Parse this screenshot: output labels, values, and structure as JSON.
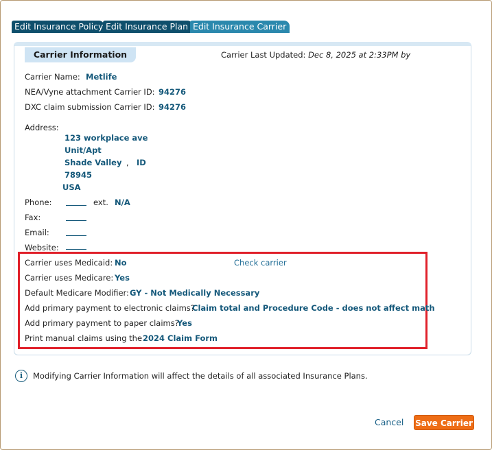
{
  "tabs": [
    {
      "label": "Edit Insurance Policy"
    },
    {
      "label": "Edit Insurance Plan"
    },
    {
      "label": "Edit Insurance Carrier"
    }
  ],
  "section": {
    "title": "Carrier Information",
    "last_updated_label": "Carrier Last Updated:",
    "last_updated_value": "Dec 8, 2025 at 2:33PM by"
  },
  "fields": {
    "carrier_name_label": "Carrier Name:",
    "carrier_name": "Metlife",
    "nea_label": "NEA/Vyne attachment Carrier ID:",
    "nea_id": "94276",
    "dxc_label": "DXC claim submission Carrier ID:",
    "dxc_id": "94276",
    "address_label": "Address:",
    "address_line1": "123 workplace ave",
    "address_line2": "Unit/Apt",
    "city": "Shade Valley",
    "comma": ",",
    "state": "ID",
    "zip": "78945",
    "country": "USA",
    "phone_label": "Phone:",
    "ext_label": "ext.",
    "ext_value": "N/A",
    "fax_label": "Fax:",
    "email_label": "Email:",
    "website_label": "Website:"
  },
  "claims": {
    "medicaid_label": "Carrier uses Medicaid:",
    "medicaid_value": "No",
    "check_carrier": "Check carrier",
    "medicare_label": "Carrier uses Medicare:",
    "medicare_value": "Yes",
    "modifier_label": "Default Medicare Modifier:",
    "modifier_value": "GY - Not Medically Necessary",
    "electronic_label": "Add primary payment to electronic claims?",
    "electronic_value": "Claim total and Procedure Code - does not affect math",
    "paper_label": "Add primary payment to paper claims?",
    "paper_value": "Yes",
    "print_label": "Print manual claims using the",
    "print_value": "2024 Claim Form"
  },
  "info": {
    "icon": "info-icon",
    "text": "Modifying Carrier Information will affect the details of all associated Insurance Plans."
  },
  "buttons": {
    "cancel": "Cancel",
    "save": "Save Carrier"
  },
  "colors": {
    "accent": "#14587a",
    "save": "#ee6d16",
    "highlight": "#e0202a"
  }
}
